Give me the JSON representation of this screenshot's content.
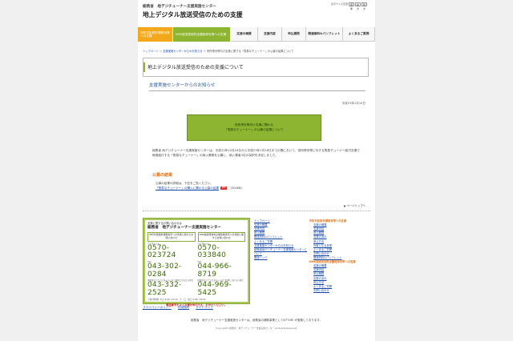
{
  "header": {
    "org": "総務省　地デジチューナー支援実施センター",
    "title": "地上デジタル放送受信のための支援",
    "fontsize_label": "文字サイズ変更",
    "fontsize_options": [
      "標準",
      "拡大",
      "特大"
    ]
  },
  "nav": {
    "orange": "市町村民税非課税世帯への支援",
    "green": "NHK放送受信料全額免除世帯への支援",
    "items": [
      "支援の概要",
      "支援内容",
      "申込期限",
      "関連資料&パンフレット",
      "よくあるご質問"
    ]
  },
  "breadcrumb": {
    "items": [
      "トップページ",
      "支援実施センターからのお知らせ"
    ],
    "current": "低所得世帯向け支援に関する「簡易なチューナー」の公募の結果について"
  },
  "main": {
    "page_title": "地上デジタル放送受信のための支援について",
    "sub_heading": "支援実施センターからのお知らせ",
    "date": "平成23年2月10日",
    "notice_line1": "低所得世帯向け支援に関わる",
    "notice_line2": "「簡易なチューナー」の公募の結果について",
    "body_text": "総務省 地デジチューナー支援実施センターは、平成22年12月24日から平成23年1月18日までの間において、低所得世帯に対する簡易チューナー給付支援で無償給付する「簡易なチューナー」の納入業務を公募し、納入業者3社の採択を決定しました。",
    "results_title": "公募の結果",
    "results_text": "公募の結果の詳細は、下記をご覧ください。",
    "results_link": "「簡易なチューナー」の購入に関わる公募の結果",
    "pdf_label": "PDF",
    "pdf_size": "（204KB）",
    "page_top": "ページトップへ"
  },
  "contact": {
    "label": "支援に関するお問い合わせは",
    "title": "総務省　地デジチューナー支援実施センター",
    "left_tag": "市町村民税非課税世帯への支援に関するお問い合わせ",
    "right_tag": "NHK放送受信料全額免除世帯への支援に関するお問い合わせ",
    "navi_label": "ナビダイヤル",
    "left_navi": "0570-023724",
    "right_navi": "0570-033840",
    "fax_label": "FAX",
    "left_fax": "043-302-0284",
    "right_fax": "044-966-8719",
    "tel_label": "IP電話などでナビダイヤルがご利用になれない場合",
    "left_tel": "043-332-2525",
    "right_tel": "044-969-5425",
    "hours": "【受付時間】平日 9:00〜21:00　土・日・祝日 9:00〜18:00",
    "warning": "電話番号をよくお確かめのうえ、おかけください。"
  },
  "footer": {
    "links": [
      "プライバシーポリシー",
      "利用規約",
      "サイトマップ"
    ],
    "col1": [
      "トップページ",
      "支援の概要",
      "支援内容",
      "申込期限",
      "関連資料&パンフレット",
      "よくあるご質問",
      "支援実施センターからのお知らせ",
      "総務省地デジチューナー支援実施センターについて",
      "関連リンク"
    ],
    "col2_head1": "市町村民税非課税世帯への支援",
    "col2_items1": [
      "支援の概要",
      "支援内容",
      "申込期限",
      "支援の流れ",
      "申込方法",
      "対象となる世帯",
      "よくあるご質問",
      "お問い合わせ",
      "関連資料&パンフレット"
    ],
    "col2_head2": "NHK放送受信料全額免除世帯への支援",
    "col2_items2": [
      "支援の概要",
      "支援内容",
      "申込期限",
      "支援の流れ",
      "申込方法",
      "よくあるご質問",
      "お問い合わせ"
    ],
    "note": "総務省　地デジチューナー支援実施センターは、総務省の補助事業としてNTT-ME が実施しております。",
    "copyright": "Copyright(c)総務省　地デジチューナー支援実施センター All Rights Reserved."
  },
  "colors": {
    "accent_green": "#8db531",
    "accent_orange": "#f3a81c",
    "link_blue": "#1a4aa8"
  }
}
